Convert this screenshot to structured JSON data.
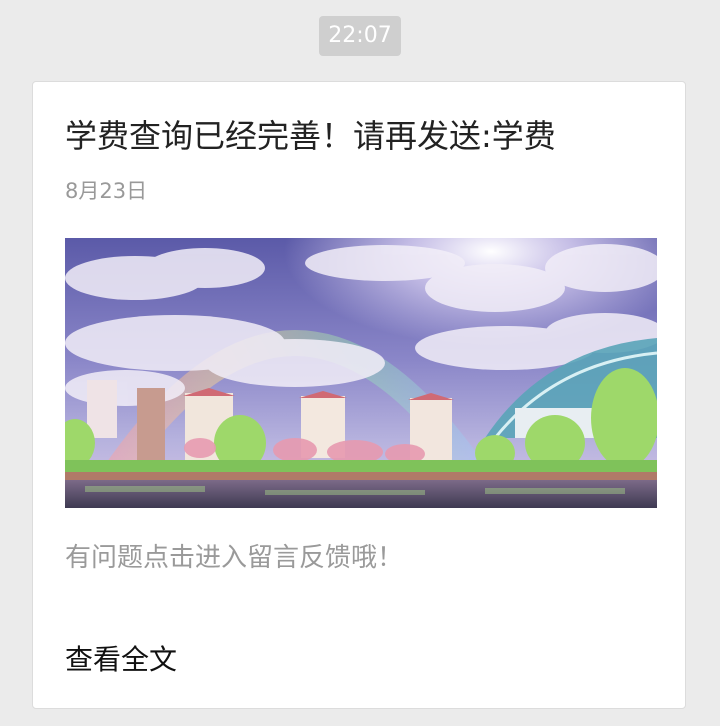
{
  "timestamp": "22:07",
  "article": {
    "title": "学费查询已经完善！请再发送:学费",
    "date": "8月23日",
    "summary": "有问题点击进入留言反馈哦！",
    "read_more_label": "查看全文"
  },
  "colors": {
    "background": "#ebebeb",
    "card": "#ffffff",
    "time_badge": "#cfcfcf"
  }
}
